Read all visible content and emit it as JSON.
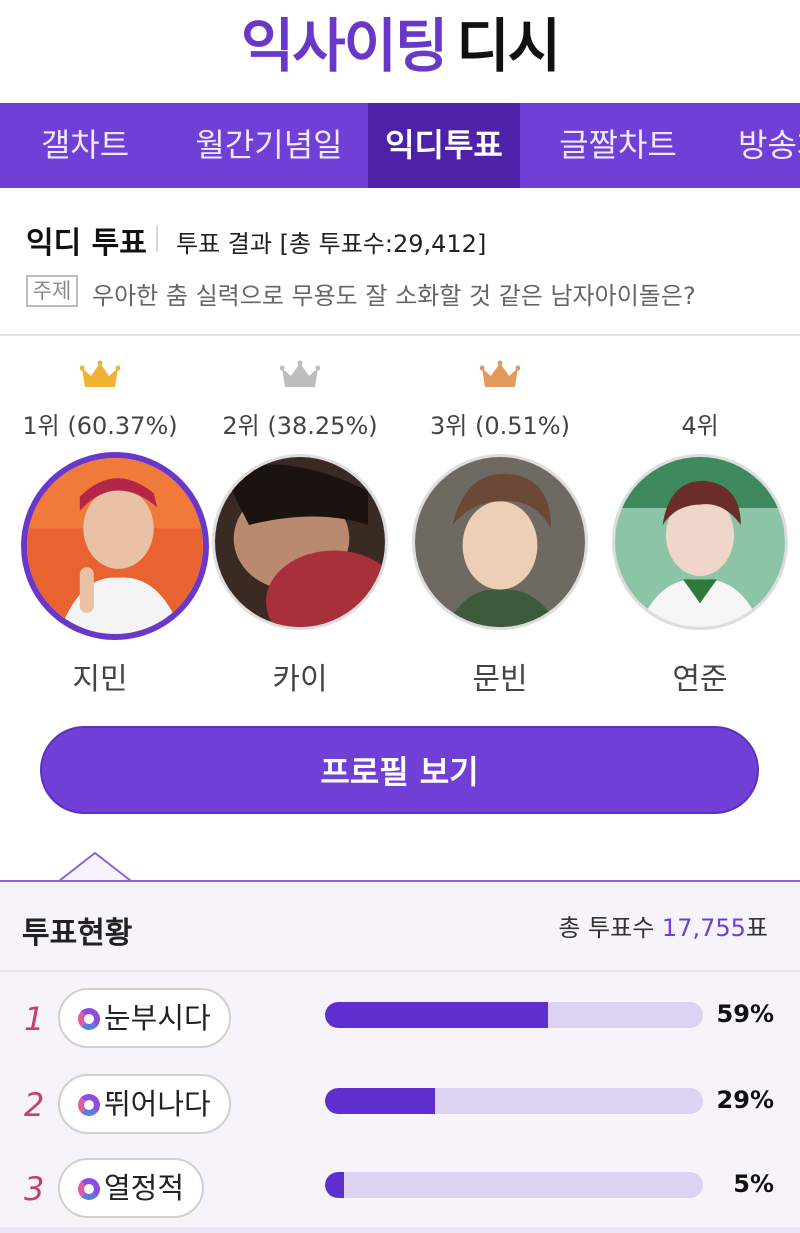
{
  "header": {
    "logo_part1": "익사이팅",
    "logo_part2": "디시"
  },
  "nav": {
    "tabs": [
      {
        "label": "갤차트"
      },
      {
        "label": "월간기념일"
      },
      {
        "label": "익디투표",
        "active": true
      },
      {
        "label": "글짤차트"
      },
      {
        "label": "방송차"
      }
    ]
  },
  "vote": {
    "title": "익디 투표",
    "result": "투표 결과 [총 투표수:29,412]",
    "topic_tag": "주제",
    "topic": "우아한 춤 실력으로 무용도 잘 소화할 것 같은 남자아이돌은?"
  },
  "ranking": [
    {
      "label": "1위 (60.37%)",
      "name": "지민",
      "crown": "gold-crown-icon"
    },
    {
      "label": "2위 (38.25%)",
      "name": "카이",
      "crown": "silver-crown-icon"
    },
    {
      "label": "3위 (0.51%)",
      "name": "문빈",
      "crown": "bronze-crown-icon"
    },
    {
      "label": "4위",
      "name": "연준"
    }
  ],
  "colors": {
    "accent": "#6f3fd6",
    "gold": "#f2b233",
    "silver": "#bdbdbd",
    "bronze": "#e2995a"
  },
  "profile_button": "프로필 보기",
  "status": {
    "title": "투표현황",
    "total_label": "총 투표수",
    "total_value": "17,755",
    "total_unit": "표",
    "rows": [
      {
        "rank": "1",
        "label": "눈부시다",
        "percent": "59%",
        "value": 0.59
      },
      {
        "rank": "2",
        "label": "뛰어나다",
        "percent": "29%",
        "value": 0.29
      },
      {
        "rank": "3",
        "label": "열정적",
        "percent": "5%",
        "value": 0.05
      }
    ]
  }
}
